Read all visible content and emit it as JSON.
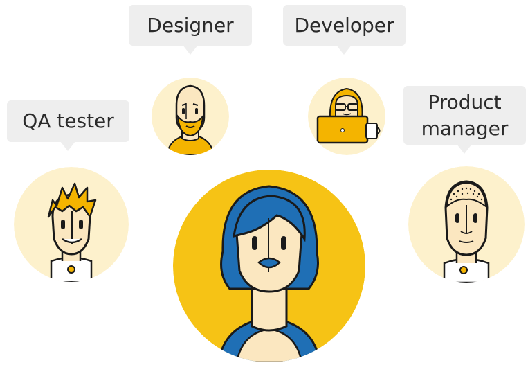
{
  "roles": {
    "designer": "Designer",
    "developer": "Developer",
    "qa_tester": "QA tester",
    "product_manager_line1": "Product",
    "product_manager_line2": "manager"
  },
  "colors": {
    "bubble_bg": "#eeeeee",
    "avatar_bg_light": "#fdf1cc",
    "avatar_bg_center": "#f6c315",
    "accent_yellow": "#f4b400",
    "hair_blue": "#1f6fb5",
    "skin": "#fbe7c0",
    "outline": "#1a1a1a"
  },
  "icons": {
    "center": "woman-blue-hair-icon",
    "designer": "bald-bearded-man-icon",
    "developer": "woman-laptop-icon",
    "qa": "spiky-hair-man-icon",
    "pm": "buzzcut-man-icon"
  }
}
